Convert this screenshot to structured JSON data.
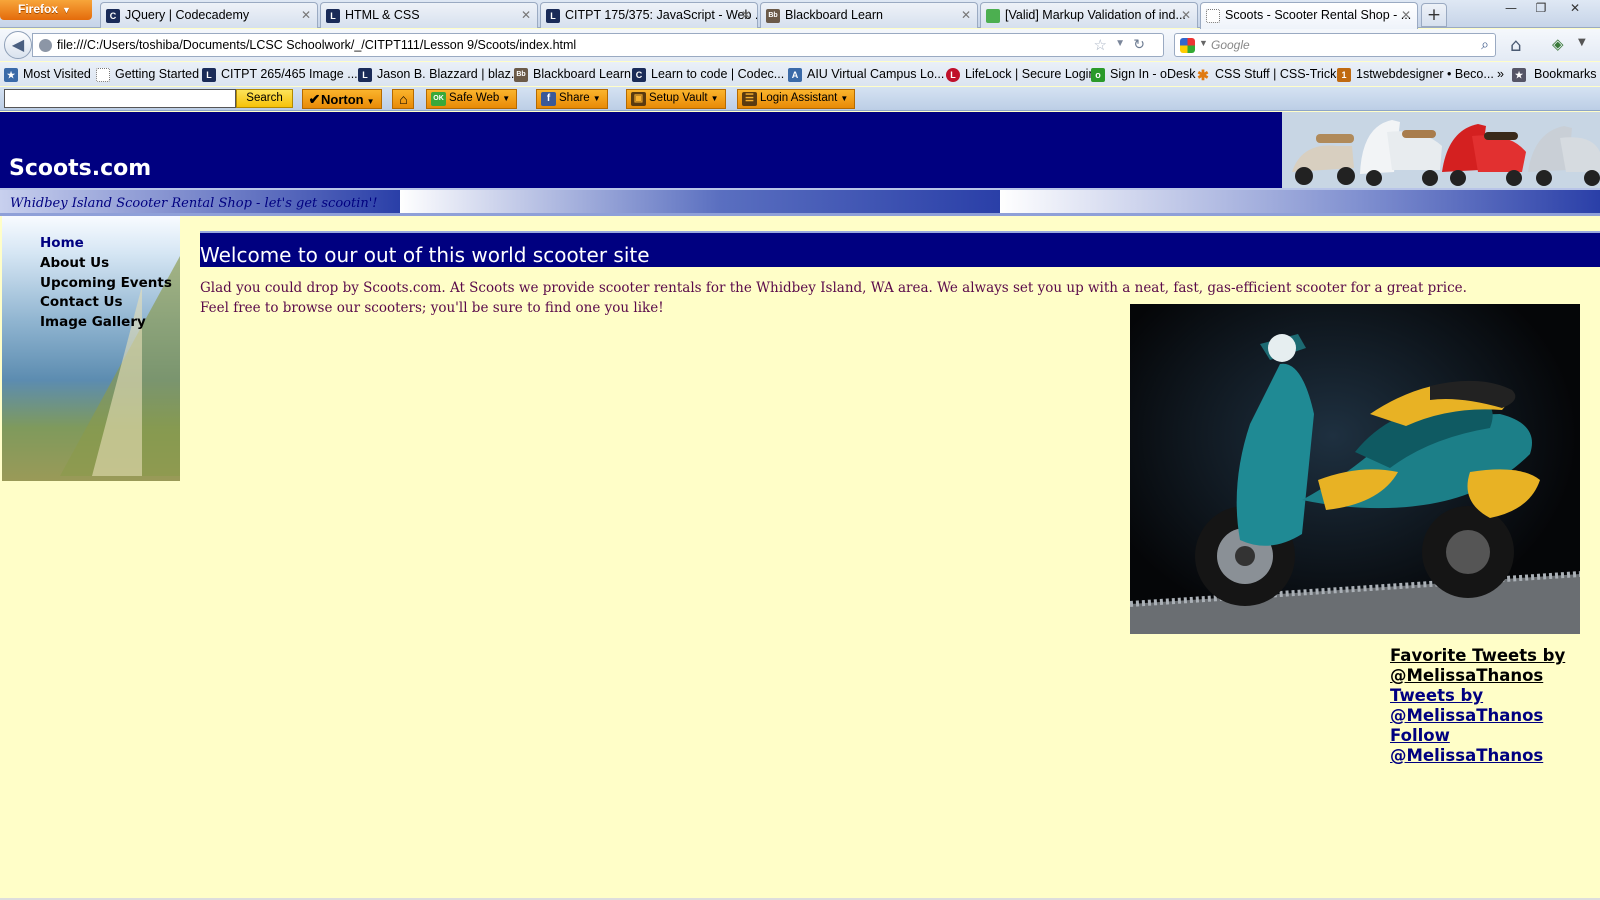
{
  "browser": {
    "menu_button": "Firefox",
    "tabs": [
      {
        "label": "JQuery | Codecademy",
        "icon": "C",
        "icon_color": "#1a2b58"
      },
      {
        "label": "HTML & CSS",
        "icon": "L",
        "icon_color": "#1a2b58"
      },
      {
        "label": "CITPT 175/375: JavaScript - Web ...",
        "icon": "L",
        "icon_color": "#1a2b58"
      },
      {
        "label": "Blackboard Learn",
        "icon": "Bb",
        "icon_color": "#6b5a48"
      },
      {
        "label": "[Valid] Markup Validation of ind...",
        "icon": "",
        "icon_color": "#4caf50"
      },
      {
        "label": "Scoots - Scooter Rental Shop - ...",
        "icon": "",
        "icon_color": "#ffffff"
      }
    ],
    "new_tab": "+",
    "window_controls": [
      "—",
      "❐",
      "✕"
    ],
    "url": "file:///C:/Users/toshiba/Documents/LCSC Schoolwork/_/CITPT111/Lesson 9/Scoots/index.html",
    "search_placeholder": "Google",
    "bookmarks": [
      {
        "label": "Most Visited",
        "icon": "★",
        "icon_color": "#3a6aa8"
      },
      {
        "label": "Getting Started",
        "icon": "",
        "icon_color": "#ffffff"
      },
      {
        "label": "CITPT 265/465 Image ...",
        "icon": "L",
        "icon_color": "#1a2b58"
      },
      {
        "label": "Jason B. Blazzard | blaz...",
        "icon": "L",
        "icon_color": "#1a2b58"
      },
      {
        "label": "Blackboard Learn",
        "icon": "Bb",
        "icon_color": "#6b5a48"
      },
      {
        "label": "Learn to code | Codec...",
        "icon": "C",
        "icon_color": "#1a2b58"
      },
      {
        "label": "AIU Virtual Campus Lo...",
        "icon": "A",
        "icon_color": "#3a6aa8"
      },
      {
        "label": "LifeLock | Secure Login",
        "icon": "L",
        "icon_color": "#c0102a"
      },
      {
        "label": "Sign In - oDesk",
        "icon": "o",
        "icon_color": "#2a9a2a"
      },
      {
        "label": "CSS Stuff | CSS-Tricks",
        "icon": "✱",
        "icon_color": "#e07a10"
      },
      {
        "label": "1stwebdesigner • Beco...",
        "icon": "1",
        "icon_color": "#c06a10"
      }
    ],
    "bookmarks_overflow": "»",
    "bookmarks_menu": "Bookmarks",
    "toolbar": {
      "search_button": "Search",
      "norton": "Norton",
      "safe_web": "Safe Web",
      "share": "Share",
      "setup_vault": "Setup Vault",
      "login_assistant": "Login Assistant"
    }
  },
  "page": {
    "site_title": "Scoots.com",
    "tagline": "Whidbey Island Scooter Rental Shop - let's get scootin'!",
    "nav": [
      "Home",
      "About Us",
      "Upcoming Events",
      "Contact Us",
      "Image Gallery"
    ],
    "welcome_heading": "Welcome to our out of this world scooter site",
    "intro_line1": "Glad you could drop by Scoots.com. At Scoots we provide scooter rentals for the Whidbey Island, WA area. We always set you up with a neat, fast, gas-efficient scooter for a great price.",
    "intro_line2": "Feel free to browse our scooters; you'll be sure to find one you like!",
    "tweets": {
      "favorite": "Favorite Tweets by @MelissaThanos",
      "tweets_by": "Tweets by @MelissaThanos",
      "follow": "Follow @MelissaThanos"
    },
    "colors": {
      "header_blue": "#000080",
      "background": "#fffec8",
      "intro_text": "#5a0a4a"
    }
  }
}
